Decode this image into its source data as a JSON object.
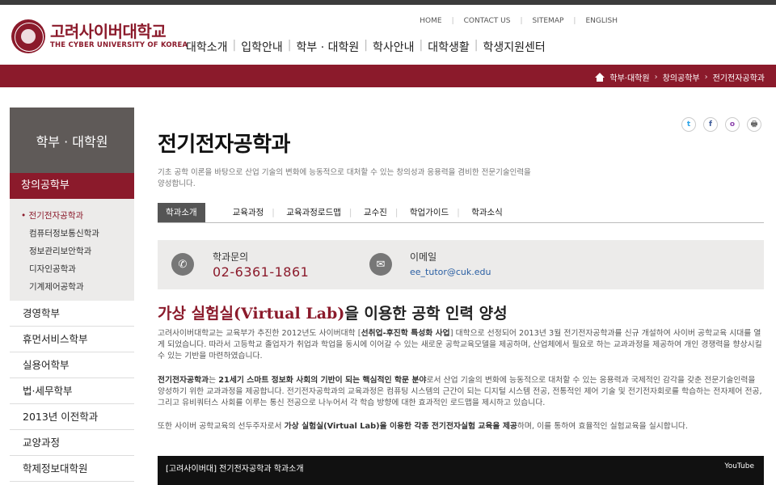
{
  "logo": {
    "name_ko": "고려사이버대학교",
    "name_en": "THE CYBER UNIVERSITY OF KOREA"
  },
  "util_links": [
    "HOME",
    "CONTACT US",
    "SITEMAP",
    "ENGLISH"
  ],
  "gnb": [
    "대학소개",
    "입학안내",
    "학부 · 대학원",
    "학사안내",
    "대학생활",
    "학생지원센터"
  ],
  "breadcrumb": [
    "학부·대학원",
    "창의공학부",
    "전기전자공학과"
  ],
  "sidebar": {
    "heading": "학부 · 대학원",
    "active_group": "창의공학부",
    "sub_items": [
      "전기전자공학과",
      "컴퓨터정보통신학과",
      "정보관리보안학과",
      "디자인공학과",
      "기계제어공학과"
    ],
    "main_items": [
      "경영학부",
      "휴먼서비스학부",
      "실용어학부",
      "법·세무학부",
      "2013년 이전학과",
      "교양과정",
      "학제정보대학원"
    ]
  },
  "share": [
    "t",
    "f",
    "o",
    "🖶"
  ],
  "page": {
    "title": "전기전자공학과",
    "intro": "기초 공학 이론을 바탕으로 산업 기술의 변화에 능동적으로 대처할 수 있는 창의성과 응용력을 겸비한 전문기술인력을 양성합니다."
  },
  "tabs": [
    "학과소개",
    "교육과정",
    "교육과정로드맵",
    "교수진",
    "학업가이드",
    "학과소식"
  ],
  "contact": {
    "phone_label": "학과문의",
    "phone": "02-6361-1861",
    "email_label": "이메일",
    "email": "ee_tutor@cuk.edu"
  },
  "lead": {
    "accent": "가상 실험실(Virtual Lab)",
    "rest": "을 이용한 공학 인력 양성"
  },
  "paragraphs": {
    "p1_a": "고려사이버대학교는 교육부가 추진한 2012년도 사이버대학 [",
    "p1_b": "선취업-후진학 특성화 사업",
    "p1_c": "] 대학으로 선정되어 2013년 3월 전기전자공학과를 신규 개설하여 사이버 공학교육 시대를 열게 되었습니다. 따라서 고등학교 졸업자가 취업과 학업을 동시에 이어갈 수 있는 새로운 공학교육모델을 제공하며, 산업체에서 필요로 하는 교과과정을 제공하여 개인 경쟁력을 향상시킬 수 있는 기반을 마련하였습니다.",
    "p2_a": "전기전자공학과",
    "p2_b": "는 ",
    "p2_c": "21세기 스마트 정보화 사회의 기반이 되는 핵심적인 학문 분야",
    "p2_d": "로서 산업 기술의 변화에 능동적으로 대처할 수 있는 응용력과 국제적인 감각을 갖춘 전문기술인력을 양성하기 위한 교과과정을 제공합니다. 전기전자공학과의 교육과정은 컴퓨팅 시스템의 근간이 되는 디지털 시스템 전공, 전통적인 제어 기술 및 전기전자회로를 학습하는 전자제어 전공, 그리고 유비쿼터스 사회를 이루는 통신 전공으로 나누어서 각 학습 방향에 대한 효과적인 로드맵을 제시하고 있습니다.",
    "p3_a": "또한 사이버 공학교육의 선두주자로서 ",
    "p3_b": "가상 실험실(Virtual Lab)을 이용한 각종 전기전자실험 교육을 제공",
    "p3_c": "하며, 이를 통하여 효율적인 실험교육을 실시합니다."
  },
  "video": {
    "title": "[고려사이버대] 전기전자공학과 학과소개",
    "brand": "YouTube"
  }
}
